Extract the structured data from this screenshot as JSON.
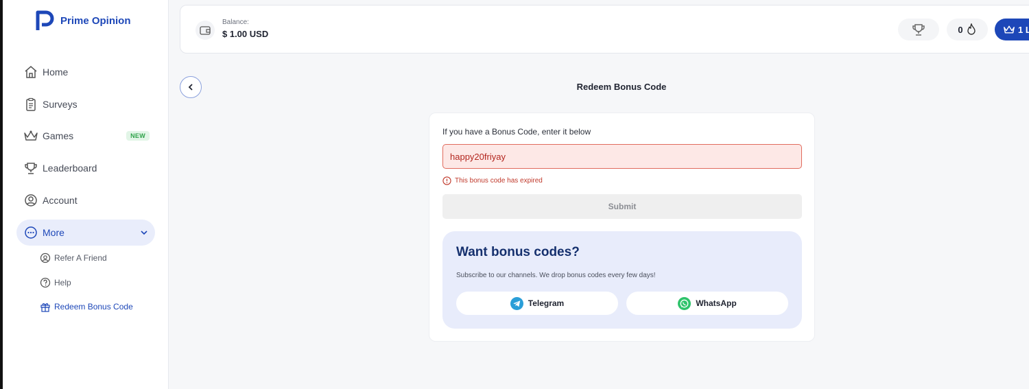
{
  "brand": {
    "name": "Prime Opinion",
    "color": "#1d47b8"
  },
  "sidebar": {
    "items": [
      {
        "label": "Home",
        "icon": "home-icon"
      },
      {
        "label": "Surveys",
        "icon": "clipboard-icon"
      },
      {
        "label": "Games",
        "icon": "crown-icon",
        "badge": "NEW"
      },
      {
        "label": "Leaderboard",
        "icon": "trophy-icon"
      },
      {
        "label": "Account",
        "icon": "user-circle-icon"
      },
      {
        "label": "More",
        "icon": "more-icon",
        "expanded": true
      }
    ],
    "sub_items": [
      {
        "label": "Refer A Friend",
        "icon": "refer-friend-icon"
      },
      {
        "label": "Help",
        "icon": "help-icon"
      },
      {
        "label": "Redeem Bonus Code",
        "icon": "gift-icon",
        "active": true
      }
    ]
  },
  "topbar": {
    "balance_label": "Balance:",
    "balance_value": "$ 1.00 USD",
    "streak_count": "0",
    "level_label": "1 Le"
  },
  "page": {
    "title": "Redeem Bonus Code"
  },
  "form": {
    "prompt": "If you have a Bonus Code, enter it below",
    "code_value": "happy20friyay",
    "error": "This bonus code has expired",
    "submit_label": "Submit"
  },
  "promo": {
    "title": "Want bonus codes?",
    "subtitle": "Subscribe to our channels. We drop bonus codes every few days!",
    "telegram_label": "Telegram",
    "whatsapp_label": "WhatsApp"
  },
  "colors": {
    "accent": "#1d47b8",
    "error": "#c0392b",
    "promo_bg": "#e8ecfb",
    "new_badge": "#2fa34a",
    "telegram": "#2a9ed8",
    "whatsapp": "#2fc36b"
  }
}
